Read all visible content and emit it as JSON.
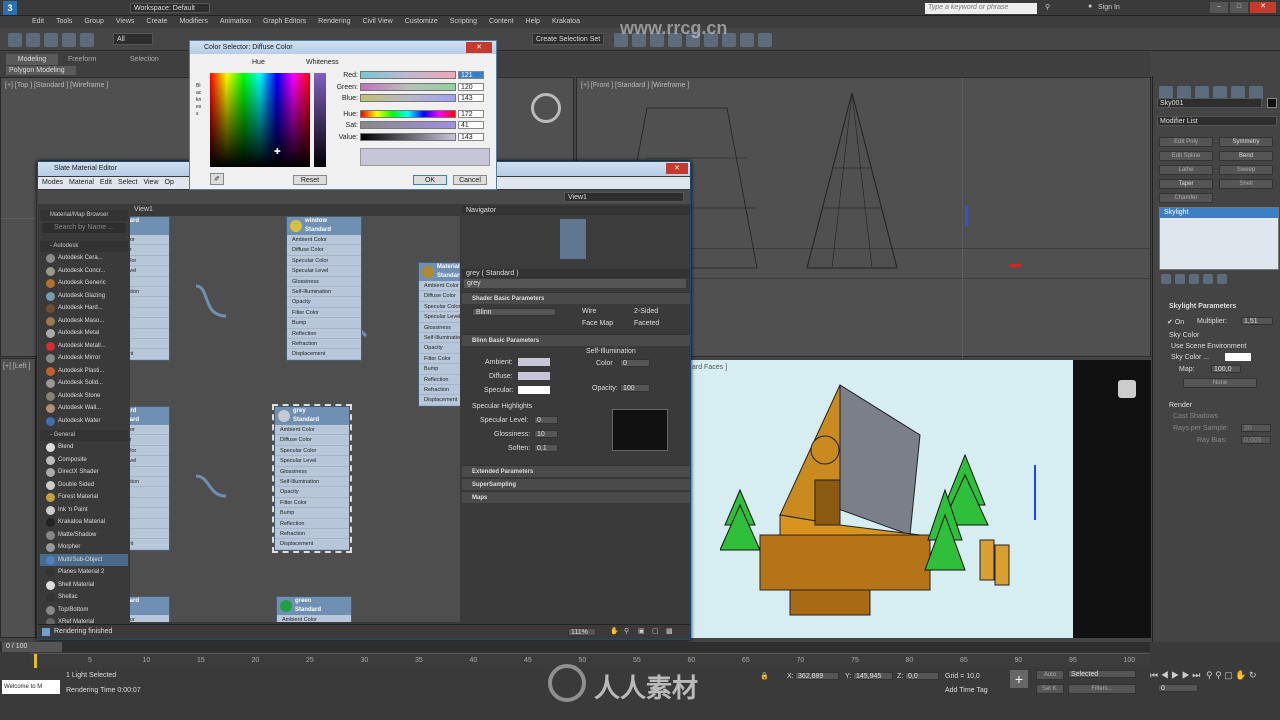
{
  "app": {
    "workspace_label": "Workspace: Default",
    "search_placeholder": "Type a keyword or phrase",
    "sign_in": "Sign In",
    "watermark": "www.rrcg.cn"
  },
  "menu": [
    "Edit",
    "Tools",
    "Group",
    "Views",
    "Create",
    "Modifiers",
    "Animation",
    "Graph Editors",
    "Rendering",
    "Civil View",
    "Customize",
    "Scripting",
    "Content",
    "Help",
    "Krakatoa"
  ],
  "toolbar": {
    "all_label": "All",
    "selection_set": "Create Selection Set"
  },
  "ribbon": {
    "tabs": [
      "Modeling",
      "Freeform",
      "Selection"
    ],
    "sub": "Polygon Modeling"
  },
  "viewports": {
    "top_label": "[+] [Top ] [Standard ] [Wireframe ]",
    "front_label": "[+] [Front ] [Standard ] [Wireframe ]",
    "left_label": "[+] [Left ]",
    "persp_label": "ard Faces ]"
  },
  "command_panel": {
    "object_name": "Sky001",
    "modifier_list": "Modifier List",
    "buttons": [
      "Edit Poly",
      "Symmetry",
      "Edit Spline",
      "Bend",
      "Lathe",
      "Sweep",
      "Taper",
      "Shell",
      "Chamfer"
    ],
    "stack_item": "Skylight",
    "params_title": "Skylight Parameters",
    "on_label": "On",
    "multiplier_label": "Multiplier:",
    "multiplier_value": "1,51",
    "sky_color_title": "Sky Color",
    "use_scene_env": "Use Scene Environment",
    "sky_color_label": "Sky Color ...",
    "map_label": "Map:",
    "map_value": "100,0",
    "none_label": "None",
    "render_title": "Render",
    "cast_shadows": "Cast Shadows",
    "rays_label": "Rays per Sample:",
    "rays_value": "20",
    "ray_bias_label": "Ray Bias:",
    "ray_bias_value": "0,005"
  },
  "sme": {
    "title": "Slate Material Editor",
    "menus": [
      "Modes",
      "Material",
      "Edit",
      "Select",
      "View",
      "Op"
    ],
    "browser_title": "Material/Map Browser",
    "browser_search": "Search by Name ...",
    "autodesk_group": "- Autodesk",
    "autodesk_items": [
      "Autodesk Cera...",
      "Autodesk Concr...",
      "Autodesk Generic",
      "Autodesk Glazing",
      "Autodesk Hard...",
      "Autodesk Maso...",
      "Autodesk Metal",
      "Autodesk Metall...",
      "Autodesk Mirror",
      "Autodesk Plasti...",
      "Autodesk Solid...",
      "Autodesk Stone",
      "Autodesk Wall...",
      "Autodesk Water"
    ],
    "general_group": "- General",
    "general_items": [
      "Blend",
      "Composite",
      "DirectX Shader",
      "Double Sided",
      "Forest Material",
      "Ink 'n Paint",
      "Krakatoa Material",
      "Matte/Shadow",
      "Morpher",
      "Multi/Sub-Object",
      "Planes Material 2",
      "Shell Material",
      "Shellac",
      "Top/Bottom",
      "XRef Material"
    ],
    "view_tab": "View1",
    "view_dropdown": "View1",
    "slots": [
      "Ambient Color",
      "Diffuse Color",
      "Specular Color",
      "Specular Level",
      "Glossiness",
      "Self-Illumination",
      "Opacity",
      "Filter Color",
      "Bump",
      "Reflection",
      "Refraction",
      "Displacement"
    ],
    "nodes": [
      {
        "name": "window",
        "type": "Standard",
        "color": "#d4c040"
      },
      {
        "name": "Material #14",
        "type": "Standard",
        "color": "#b08a30"
      },
      {
        "name": "grey",
        "type": "Standard",
        "color": "#c8c8d0"
      },
      {
        "name": "Mustard",
        "type": "Standard",
        "color": "#c8a040"
      },
      {
        "name": "green",
        "type": "Standard",
        "color": "#20a040"
      },
      {
        "name": "",
        "type": "Standard",
        "color": "#c04040"
      }
    ],
    "left_nodes": [
      {
        "name": "",
        "type": "Standard"
      },
      {
        "name": "Mustard",
        "type": "Standard"
      }
    ],
    "navigator": "Navigator",
    "pe_title": "grey  ( Standard )",
    "pe_name": "grey",
    "shader_basic": "Shader Basic Parameters",
    "shader": "Blinn",
    "wire": "Wire",
    "two_sided": "2-Sided",
    "face_map": "Face Map",
    "faceted": "Faceted",
    "blinn_basic": "Blinn Basic Parameters",
    "self_illum": "Self-Illumination",
    "ambient": "Ambient:",
    "diffuse": "Diffuse:",
    "specular": "Specular:",
    "color_label": "Color",
    "color_value": "0",
    "opacity_label": "Opacity:",
    "opacity_value": "100",
    "spec_highlights": "Specular Highlights",
    "spec_level": "Specular Level:",
    "spec_level_value": "0",
    "glossiness": "Glossiness:",
    "glossiness_value": "10",
    "soften": "Soften:",
    "soften_value": "0,1",
    "extended": "Extended Parameters",
    "supersampling": "SuperSampling",
    "maps": "Maps",
    "status": "Rendering finished",
    "zoom": "111%"
  },
  "color_selector": {
    "title": "Color Selector: Diffuse Color",
    "hue": "Hue",
    "whiteness": "Whiteness",
    "blackness": "Blackness",
    "rows": [
      {
        "label": "Red:",
        "value": "121"
      },
      {
        "label": "Green:",
        "value": "120"
      },
      {
        "label": "Blue:",
        "value": "143"
      },
      {
        "label": "Hue:",
        "value": "172"
      },
      {
        "label": "Sat:",
        "value": "41"
      },
      {
        "label": "Value:",
        "value": "143"
      }
    ],
    "reset": "Reset",
    "ok": "OK",
    "cancel": "Cancel",
    "preview_color": "#c7c6d8"
  },
  "timeline": {
    "frame": "0 / 100",
    "ticks": [
      "5",
      "10",
      "15",
      "20",
      "25",
      "30",
      "35",
      "40",
      "45",
      "50",
      "55",
      "60",
      "65",
      "70",
      "75",
      "80",
      "85",
      "90",
      "95",
      "100"
    ],
    "script": "Welcome to M",
    "selection_status": "1 Light Selected",
    "render_time": "Rendering Time  0:00:07",
    "x_label": "X:",
    "x_value": "362,889",
    "y_label": "Y:",
    "y_value": "145,945",
    "z_label": "Z:",
    "z_value": "0,0",
    "grid": "Grid = 10,0",
    "add_time_tag": "Add Time Tag",
    "auto": "Auto",
    "selected": "Selected",
    "set_k": "Set K.",
    "filters": "Filters...",
    "frame_field": "0",
    "logo_text": "人人素材"
  }
}
